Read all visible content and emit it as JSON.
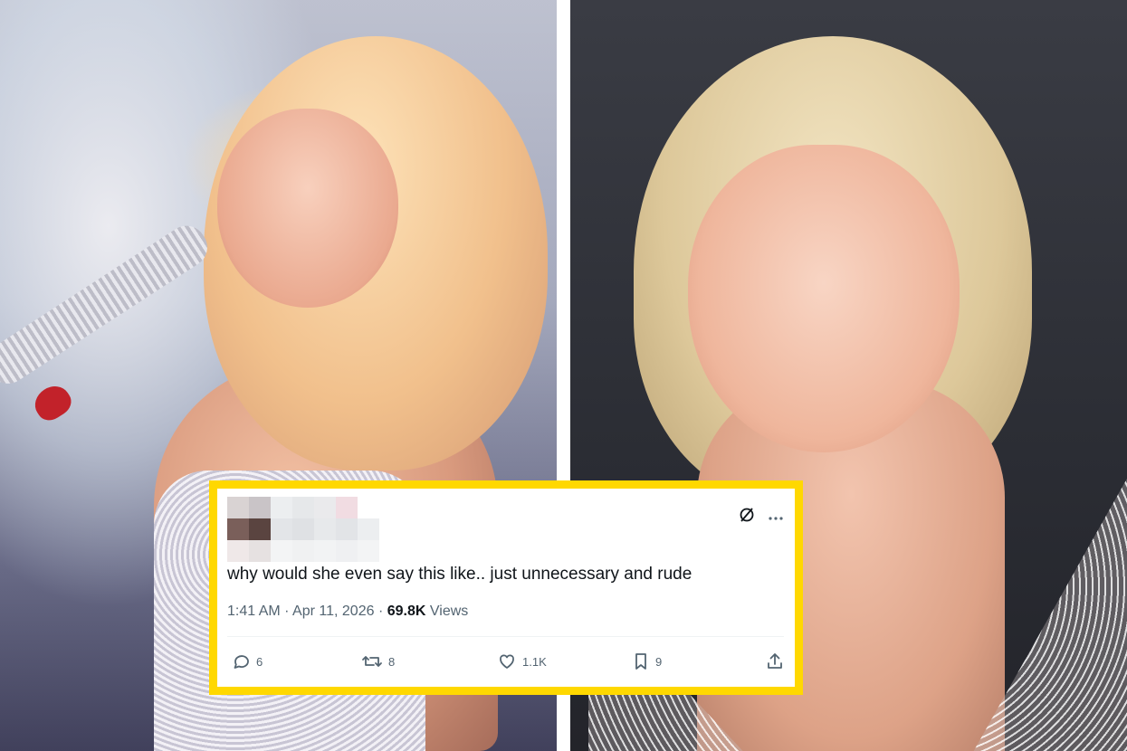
{
  "photos": {
    "left": {
      "subject": "performer-with-microphone"
    },
    "right": {
      "subject": "red-carpet-portrait"
    }
  },
  "tweet": {
    "border_color": "#ffd800",
    "author_redacted": true,
    "text": "why would she even say this like.. just unnecessary and rude",
    "time": "1:41 AM",
    "dot1": "·",
    "date": "Apr 11, 2026",
    "dot2": "·",
    "views_count": "69.8K",
    "views_label": "Views",
    "icons": {
      "grok": "slashed-circle-icon",
      "more": "more-icon"
    },
    "actions": {
      "replies": {
        "icon": "reply-icon",
        "count": "6"
      },
      "reposts": {
        "icon": "repost-icon",
        "count": "8"
      },
      "likes": {
        "icon": "like-icon",
        "count": "1.1K"
      },
      "bookmarks": {
        "icon": "bookmark-icon",
        "count": "9"
      },
      "share": {
        "icon": "share-icon"
      }
    },
    "colors": {
      "text": "#0f1419",
      "muted": "#536471"
    }
  }
}
